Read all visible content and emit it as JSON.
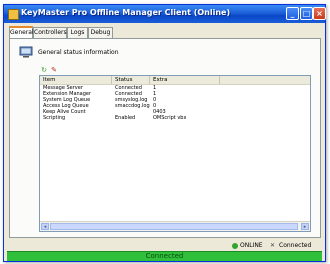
{
  "window": {
    "title": "KeyMaster Pro Offline Manager Client (Online)",
    "controls": {
      "minimize": "_",
      "maximize": "□",
      "close": "×"
    }
  },
  "tabs": [
    {
      "label": "General",
      "active": true
    },
    {
      "label": "Controllers",
      "active": false
    },
    {
      "label": "Logs",
      "active": false
    },
    {
      "label": "Debug",
      "active": false
    }
  ],
  "panel": {
    "header_icon": "computer-icon",
    "title": "General status information"
  },
  "toolbar": [
    {
      "icon": "refresh-icon",
      "glyph": "↻",
      "color": "#3a9a2a"
    },
    {
      "icon": "edit-icon",
      "glyph": "✎",
      "color": "#b03020"
    }
  ],
  "table": {
    "columns": [
      "Item",
      "Status",
      "Extra"
    ],
    "rows": [
      [
        "Message Server",
        "Connected",
        "1"
      ],
      [
        "Extension Manager",
        "Connected",
        "1"
      ],
      [
        "System Log Queue",
        "smsyslog.log",
        "0"
      ],
      [
        "Access Log Queue",
        "smaccdog.log",
        "0"
      ],
      [
        "Keep Alive Count",
        "",
        "0403"
      ],
      [
        "Scripting",
        "Enabled",
        "OMScript vbx"
      ]
    ]
  },
  "scrollbar": {
    "left": "◂",
    "right": "▸"
  },
  "status": {
    "online_label": "ONLINE",
    "connected_label": "Connected",
    "bar_text": "Connected",
    "online_color": "#2fa52f",
    "bar_color": "#2fbf3a"
  }
}
